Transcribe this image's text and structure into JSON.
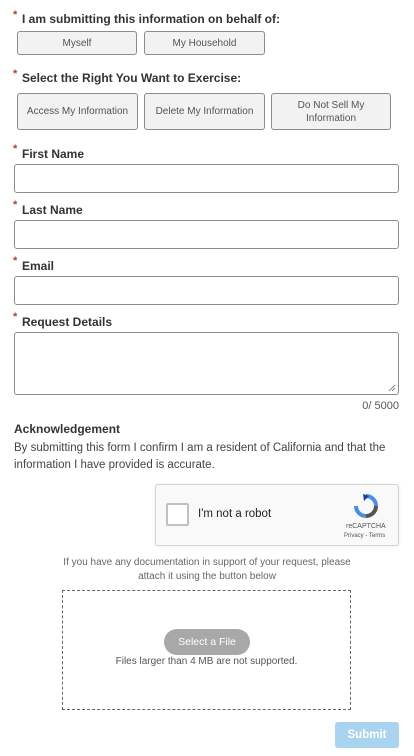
{
  "behalf": {
    "label": "I am submitting this information on behalf of:",
    "options": [
      "Myself",
      "My Household"
    ]
  },
  "right": {
    "label": "Select the Right You Want to Exercise:",
    "options": [
      "Access My Information",
      "Delete My Information",
      "Do Not Sell My Information"
    ]
  },
  "fields": {
    "first_name": "First Name",
    "last_name": "Last Name",
    "email": "Email",
    "request_details": "Request Details",
    "char_count": "0/ 5000"
  },
  "ack": {
    "title": "Acknowledgement",
    "text": "By submitting this form I confirm I am a resident of California and that the information I have provided is accurate."
  },
  "captcha": {
    "label": "I'm not a robot",
    "brand": "reCAPTCHA",
    "links": "Privacy - Terms"
  },
  "upload": {
    "note": "If you have any documentation in support of your request, please attach it using the button below",
    "button": "Select a File",
    "limit": "Files larger than 4 MB are not supported."
  },
  "submit": "Submit",
  "colors": {
    "required": "#c0392b",
    "submit": "#a8d4ef"
  }
}
